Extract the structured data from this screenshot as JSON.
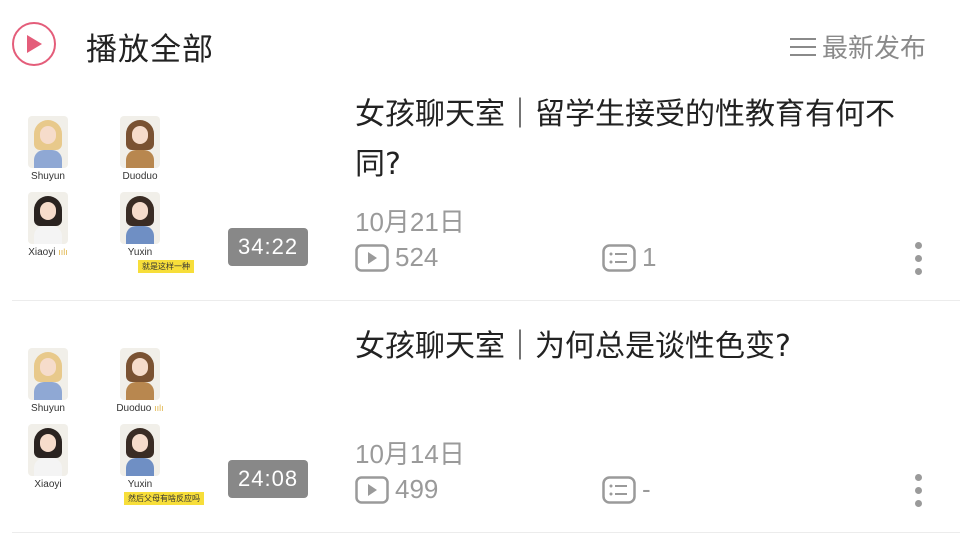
{
  "header": {
    "play_all_label": "播放全部",
    "sort_label": "最新发布",
    "accent_color": "#e45d7a"
  },
  "items": [
    {
      "title": "女孩聊天室｜留学生接受的性教育有何不同?",
      "date": "10月21日",
      "plays": "524",
      "comments": "1",
      "duration": "34:22",
      "thumb": {
        "names": [
          "Shuyun",
          "Duoduo",
          "Xiaoyi",
          "Yuxin"
        ],
        "caption": "就是这样一种"
      }
    },
    {
      "title": "女孩聊天室｜为何总是谈性色变?",
      "date": "10月14日",
      "plays": "499",
      "comments": "-",
      "duration": "24:08",
      "thumb": {
        "names": [
          "Shuyun",
          "Duoduo",
          "Xiaoyi",
          "Yuxin"
        ],
        "caption": "然后父母有啥反应吗"
      }
    }
  ]
}
